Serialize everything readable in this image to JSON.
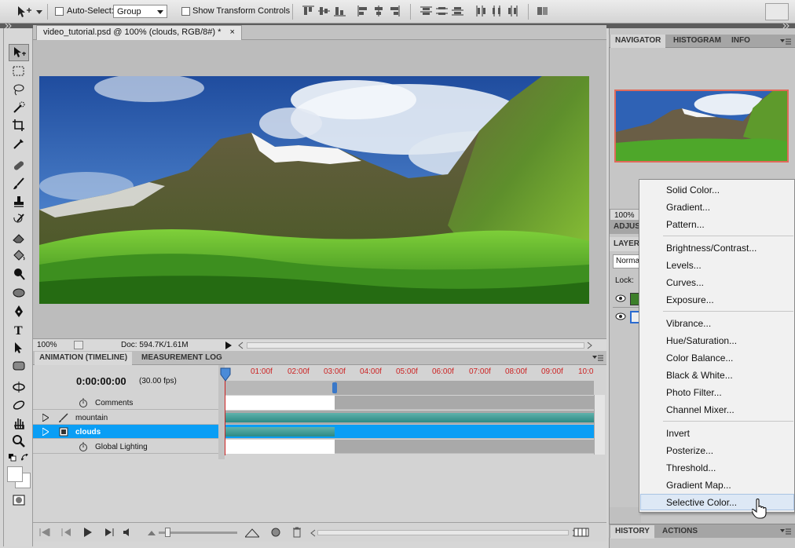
{
  "options_bar": {
    "auto_select_label": "Auto-Select:",
    "auto_select_value": "Group",
    "show_transform_label": "Show Transform Controls"
  },
  "document": {
    "tab_title": "video_tutorial.psd @ 100% (clouds, RGB/8#) *",
    "close_glyph": "×",
    "zoom": "100%",
    "doc_info": "Doc: 594.7K/1.61M"
  },
  "animation": {
    "tabs": [
      "ANIMATION (TIMELINE)",
      "MEASUREMENT LOG"
    ],
    "timecode": "0:00:00:00",
    "fps": "(30.00 fps)",
    "ruler": [
      "01:00f",
      "02:00f",
      "03:00f",
      "04:00f",
      "05:00f",
      "06:00f",
      "07:00f",
      "08:00f",
      "09:00f",
      "10:0"
    ],
    "rows": [
      {
        "label": "Comments"
      },
      {
        "label": "mountain"
      },
      {
        "label": "clouds"
      },
      {
        "label": "Global Lighting"
      }
    ]
  },
  "right_panel": {
    "nav_tabs": [
      "NAVIGATOR",
      "HISTOGRAM",
      "INFO"
    ],
    "zoom": "100%",
    "adjust_tab": "ADJUS",
    "layers_tab": "LAYER",
    "blend_mode": "Norma",
    "lock_label": "Lock:",
    "bottom_tabs": [
      "HISTORY",
      "ACTIONS"
    ]
  },
  "adjustment_menu": {
    "group1": [
      "Solid Color...",
      "Gradient...",
      "Pattern..."
    ],
    "group2": [
      "Brightness/Contrast...",
      "Levels...",
      "Curves...",
      "Exposure..."
    ],
    "group3": [
      "Vibrance...",
      "Hue/Saturation...",
      "Color Balance...",
      "Black & White...",
      "Photo Filter...",
      "Channel Mixer..."
    ],
    "group4": [
      "Invert",
      "Posterize...",
      "Threshold...",
      "Gradient Map...",
      "Selective Color..."
    ]
  },
  "colors": {
    "selection_blue": "#0a9ef5",
    "layer_bar_teal": "#2d8a84",
    "ruler_red": "#cc2222"
  }
}
